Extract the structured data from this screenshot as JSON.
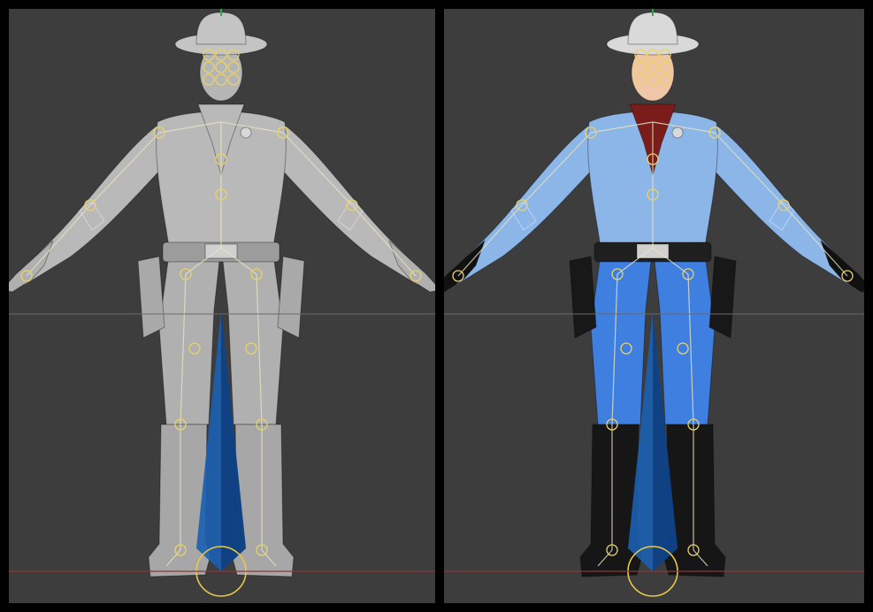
{
  "viewports": [
    {
      "id": "left",
      "shading": "solid-clay",
      "colors": {
        "shirt": "#b9b9b9",
        "pants": "#b0b0b0",
        "boots": "#a7a7a7",
        "hat": "#c4c4c4",
        "skin": "#b5b5b5",
        "scarf": "#b9b9b9",
        "belt": "#9c9c9c",
        "holster": "#a9a9a9",
        "gloves": "#b0b0b0"
      }
    },
    {
      "id": "right",
      "shading": "textured",
      "colors": {
        "shirt": "#8db6e8",
        "pants": "#3f7fe0",
        "boots": "#161616",
        "hat": "#d9d9d9",
        "skin": "#f0c6a8",
        "scarf": "#7a1d1a",
        "belt": "#1f1f1f",
        "holster": "#181818",
        "gloves": "#111111"
      }
    }
  ],
  "scene": {
    "background": "#3d3d3e",
    "grid_line": "#6a6a6a",
    "ground_line": "#8a3a3a",
    "axis_green": "#2fa84a",
    "rig_bone": "#e8e4c0",
    "rig_joint": "#e9d26a",
    "root_bone": "#1b5fb0",
    "root_bone_dark": "#0d3e80",
    "root_circle": "#e8c84a"
  },
  "overlays": [
    "skeleton-rig",
    "root-bone",
    "ground-grid"
  ]
}
